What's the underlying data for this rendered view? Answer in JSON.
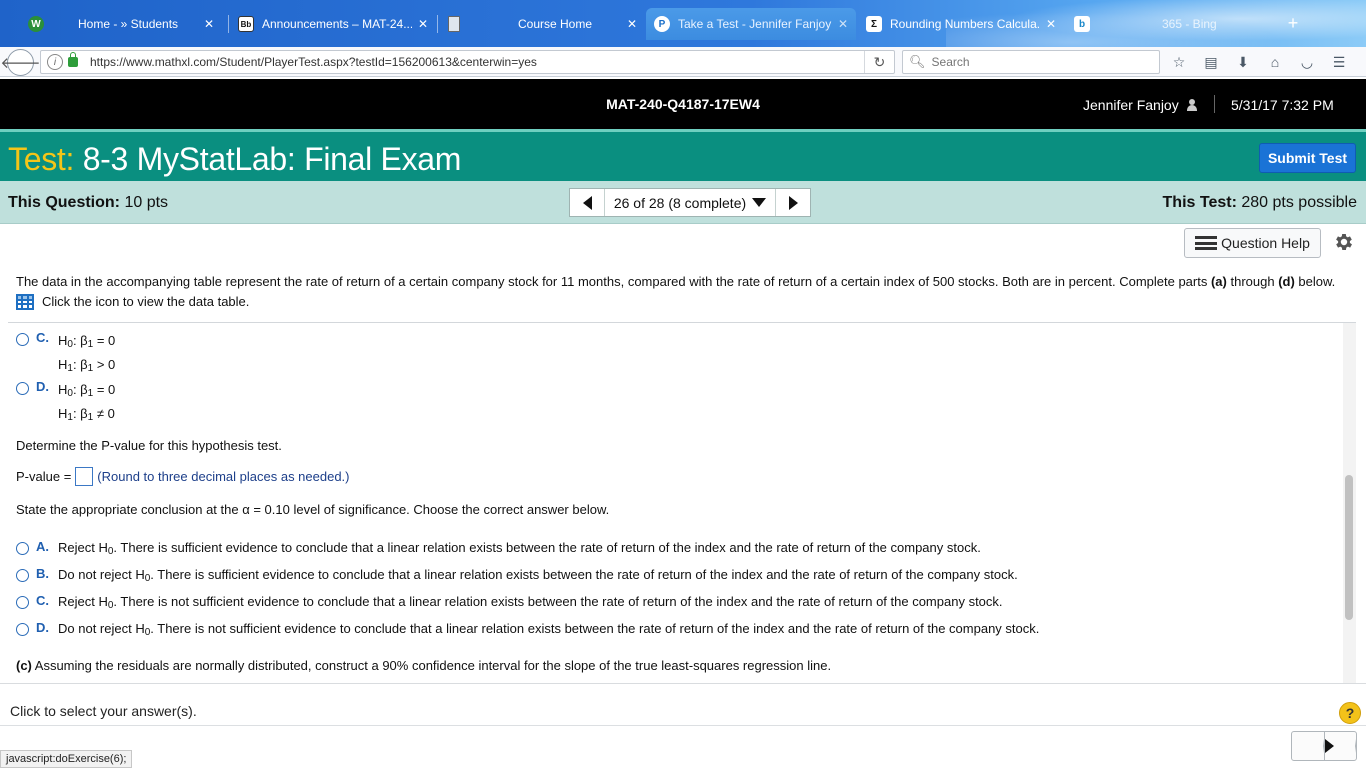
{
  "browser": {
    "tabs": [
      {
        "label": "Home - » Students",
        "favicon": "W",
        "favicon_color": "#2a8f3a"
      },
      {
        "label": "Announcements – MAT-24...",
        "favicon": "Bb",
        "favicon_color": "#222222"
      },
      {
        "label": "Course Home",
        "favicon": "",
        "favicon_color": "#555555"
      },
      {
        "label": "Take a Test - Jennifer Fanjoy",
        "favicon": "P",
        "favicon_color": "#1a6fc9"
      },
      {
        "label": "Rounding Numbers Calcula...",
        "favicon": "Σ",
        "favicon_color": "#222222"
      },
      {
        "label": "",
        "favicon": "b",
        "favicon_color": "#1a88c9"
      },
      {
        "label": "365 - Bing",
        "favicon": "",
        "favicon_color": "#2f7fd9"
      }
    ],
    "url": "https://www.mathxl.com/Student/PlayerTest.aspx?testId=156200613&centerwin=yes",
    "search_placeholder": "Search"
  },
  "header": {
    "course": "MAT-240-Q4187-17EW4",
    "user": "Jennifer Fanjoy",
    "datetime": "5/31/17 7:32 PM"
  },
  "test": {
    "prefix": "Test:",
    "title": "8-3 MyStatLab: Final Exam",
    "submit_label": "Submit Test"
  },
  "question_bar": {
    "this_question_label": "This Question:",
    "this_question_value": "10 pts",
    "position": "26 of 28 (8 complete)",
    "this_test_label": "This Test:",
    "this_test_value": "280 pts possible"
  },
  "question_help_label": "Question Help",
  "question": {
    "intro_text": "The data in the accompanying table represent the rate of return of a certain company stock for 11 months, compared with the rate of return of a certain index of 500 stocks. Both are in percent. Complete parts ",
    "intro_a": "(a)",
    "intro_through": " through ",
    "intro_d": "(d)",
    "intro_end": " below.",
    "data_table_link": "Click the icon to view the data table.",
    "hypothesis_options": [
      {
        "letter": "C.",
        "h0_rel": "= 0",
        "h1_rel": "> 0"
      },
      {
        "letter": "D.",
        "h0_rel": "= 0",
        "h1_rel": "≠ 0"
      }
    ],
    "pvalue_prompt": "Determine the P-value for this hypothesis test.",
    "pvalue_label": "P-value =",
    "pvalue_hint": "(Round to three decimal places as needed.)",
    "conclusion_prompt": "State the appropriate conclusion at the α = 0.10 level of significance. Choose the correct answer below.",
    "conclusion_options": [
      {
        "letter": "A.",
        "pre": "Reject H",
        "post": ". There is sufficient evidence to conclude that a linear relation exists between the rate of return of the index and the rate of return of the company stock."
      },
      {
        "letter": "B.",
        "pre": "Do not reject H",
        "post": ". There is sufficient evidence to conclude that a linear relation exists between the rate of return of the index and the rate of return of the company stock."
      },
      {
        "letter": "C.",
        "pre": "Reject H",
        "post": ". There is not sufficient evidence to conclude that a linear relation exists between the rate of return of the index and the rate of return of the company stock."
      },
      {
        "letter": "D.",
        "pre": "Do not reject H",
        "post": ". There is not sufficient evidence to conclude that a linear relation exists between the rate of return of the index and the rate of return of the company stock."
      }
    ],
    "part_c_label": "(c)",
    "part_c_text": " Assuming the residuals are normally distributed, construct a 90% confidence interval for the slope of the true least-squares regression line."
  },
  "footer": {
    "message": "Click to select your answer(s).",
    "help_symbol": "?",
    "status_text": "javascript:doExercise(6);"
  },
  "colors": {
    "teal_bar": "#0a8f80",
    "question_bar": "#bfe0dc",
    "accent_blue": "#1a73d6",
    "title_prefix": "#f5c518"
  }
}
